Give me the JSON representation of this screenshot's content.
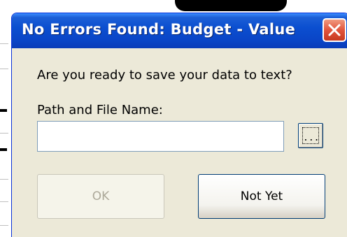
{
  "dialog": {
    "title": "No Errors Found: Budget - Value",
    "close_icon": "close-icon",
    "prompt": "Are you ready to save your data to text?",
    "path_label": "Path and File Name:",
    "path_input": {
      "value": "",
      "placeholder": ""
    },
    "browse_label": "...",
    "ok_label": "OK",
    "ok_enabled": false,
    "not_yet_label": "Not Yet"
  },
  "colors": {
    "titlebar": "#0a44c6",
    "close_button": "#e2543c",
    "dialog_bg": "#ece9d8"
  }
}
